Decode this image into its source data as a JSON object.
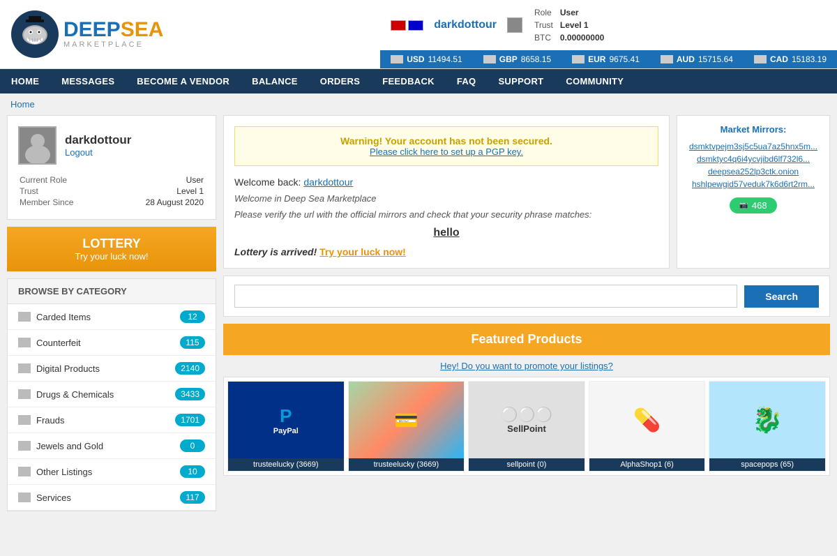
{
  "header": {
    "logo_main": "DEEPSEA",
    "logo_sub": "MARKETPLACE",
    "username": "darkdottour",
    "logout_label": "Logout",
    "role_label": "Role",
    "role_value": "User",
    "trust_label": "Trust",
    "trust_value": "Level 1",
    "btc_label": "BTC",
    "btc_value": "0.00000000"
  },
  "currencies": [
    {
      "code": "USD",
      "value": "11494.51"
    },
    {
      "code": "GBP",
      "value": "8658.15"
    },
    {
      "code": "EUR",
      "value": "9675.41"
    },
    {
      "code": "AUD",
      "value": "15715.64"
    },
    {
      "code": "CAD",
      "value": "15183.19"
    }
  ],
  "nav": {
    "items": [
      "HOME",
      "MESSAGES",
      "BECOME A VENDOR",
      "BALANCE",
      "ORDERS",
      "FEEDBACK",
      "FAQ",
      "SUPPORT",
      "COMMUNITY"
    ]
  },
  "breadcrumb": "Home",
  "profile": {
    "username": "darkdottour",
    "logout": "Logout",
    "current_role_label": "Current Role",
    "current_role_value": "User",
    "trust_label": "Trust",
    "trust_value": "Level 1",
    "member_since_label": "Member Since",
    "member_since_value": "28 August 2020"
  },
  "lottery": {
    "title": "LOTTERY",
    "subtitle": "Try your luck now!"
  },
  "browse": {
    "header": "BROWSE BY CATEGORY",
    "categories": [
      {
        "name": "Carded Items",
        "count": "12"
      },
      {
        "name": "Counterfeit",
        "count": "115"
      },
      {
        "name": "Digital Products",
        "count": "2140"
      },
      {
        "name": "Drugs & Chemicals",
        "count": "3433"
      },
      {
        "name": "Frauds",
        "count": "1701"
      },
      {
        "name": "Jewels and Gold",
        "count": "0"
      },
      {
        "name": "Other Listings",
        "count": "10"
      },
      {
        "name": "Services",
        "count": "117"
      }
    ]
  },
  "warning": {
    "title": "Warning! Your account has not been secured.",
    "link_text": "Please click here to set up a PGP key."
  },
  "welcome": {
    "prefix": "Welcome back:",
    "username": "darkdottour",
    "line1": "Welcome in Deep Sea Marketplace",
    "line2": "Please verify the url with the official mirrors and check that your security phrase matches:",
    "phrase": "hello",
    "lottery_text": "Lottery is arrived!",
    "lottery_link": "Try your luck now!"
  },
  "mirrors": {
    "title": "Market Mirrors:",
    "links": [
      "dsmktvpejm3sj5c5ua7az5hnx5m...",
      "dsmktyc4q6i4ycvjibd6lf732l6...",
      "deepsea252lp3ctk.onion",
      "hshlpewgid57veduk7k6d6rt2rm..."
    ],
    "online_count": "468"
  },
  "search": {
    "placeholder": "",
    "button_label": "Search"
  },
  "featured": {
    "title": "Featured Products",
    "promote_text": "Hey! Do you want to promote your listings?",
    "products": [
      {
        "seller": "trusteelucky (3669)",
        "type": "paypal",
        "label": "PayPal"
      },
      {
        "seller": "trusteelucky (3669)",
        "type": "cards",
        "label": ""
      },
      {
        "seller": "sellpoint (0)",
        "type": "pills",
        "label": "SellPoint"
      },
      {
        "seller": "AlphaShop1 (6)",
        "type": "bottle",
        "label": ""
      },
      {
        "seller": "spacepops (65)",
        "type": "cartoon",
        "label": ""
      }
    ]
  }
}
